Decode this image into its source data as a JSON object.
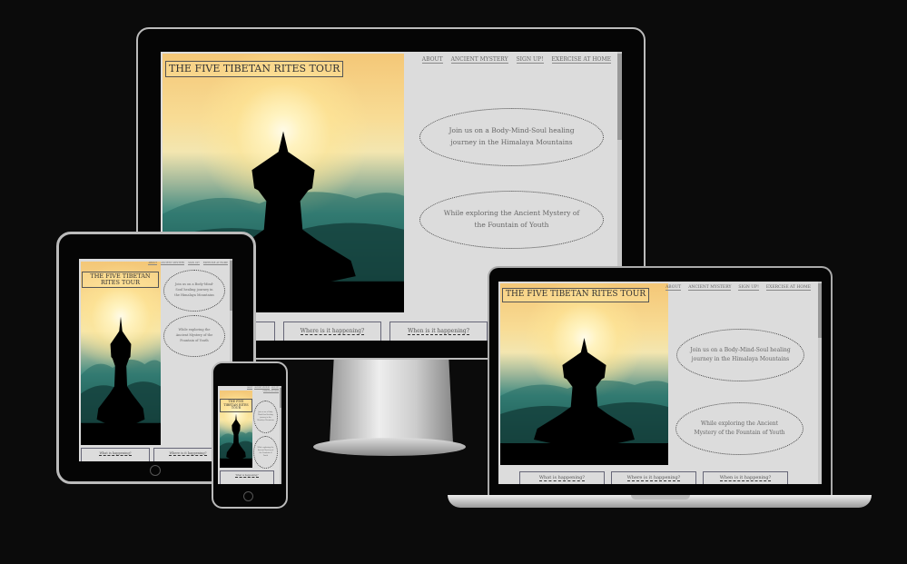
{
  "site": {
    "title": "THE FIVE TIBETAN RITES TOUR",
    "nav": [
      "ABOUT",
      "ANCIENT MYSTERY",
      "SIGN UP!",
      "EXERCISE AT HOME"
    ],
    "tagline_1": "Join us on a Body-Mind-Soul healing journey in the Himalaya Mountains",
    "tagline_2": "While exploring the Ancient Mystery of the Fountain of Youth",
    "boxes": [
      "What is happening?",
      "Where is it happening?",
      "When is it happening?"
    ]
  },
  "colors": {
    "background": "#0b0b0b",
    "page": "#dcdcdc",
    "text": "#555555"
  }
}
